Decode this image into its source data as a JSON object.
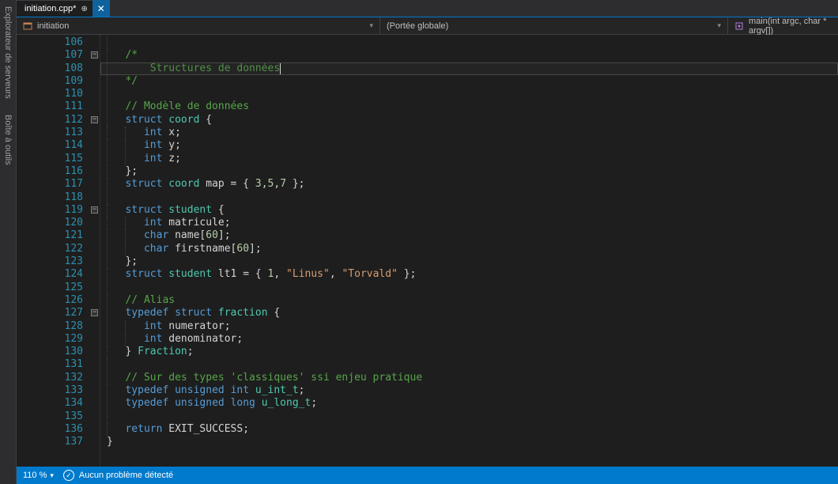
{
  "side_panels": {
    "explorer": "Explorateur de serveurs",
    "toolbox": "Boîte à outils"
  },
  "tab": {
    "title": "initiation.cpp*"
  },
  "nav": {
    "scope1": "initiation",
    "scope2": "(Portée globale)",
    "scope3": "main(int argc, char * argv[])"
  },
  "code_lines": [
    {
      "num": 106,
      "mark": false,
      "fold": "",
      "html": ""
    },
    {
      "num": 107,
      "mark": false,
      "fold": "box",
      "html": "<span class='c-comment'>/*</span>"
    },
    {
      "num": 108,
      "mark": false,
      "fold": "",
      "html": "<span class='c-comment'>    Structures de données</span>",
      "highlight": true
    },
    {
      "num": 109,
      "mark": false,
      "fold": "",
      "html": "<span class='c-comment'>*/</span>"
    },
    {
      "num": 110,
      "mark": true,
      "fold": "",
      "html": ""
    },
    {
      "num": 111,
      "mark": true,
      "fold": "",
      "html": "<span class='c-comment'>// Modèle de données</span>"
    },
    {
      "num": 112,
      "mark": true,
      "fold": "box",
      "html": "<span class='c-kw'>struct</span> <span class='c-type'>coord</span> {"
    },
    {
      "num": 113,
      "mark": false,
      "fold": "",
      "html": "    <span class='c-kw'>int</span> x;"
    },
    {
      "num": 114,
      "mark": false,
      "fold": "",
      "html": "    <span class='c-kw'>int</span> y;"
    },
    {
      "num": 115,
      "mark": false,
      "fold": "",
      "html": "    <span class='c-kw'>int</span> z;"
    },
    {
      "num": 116,
      "mark": false,
      "fold": "",
      "html": "};"
    },
    {
      "num": 117,
      "mark": true,
      "fold": "",
      "html": "<span class='c-kw'>struct</span> <span class='c-type'>coord</span> map = { <span class='c-num'>3</span>,<span class='c-num'>5</span>,<span class='c-num'>7</span> };"
    },
    {
      "num": 118,
      "mark": false,
      "fold": "",
      "html": ""
    },
    {
      "num": 119,
      "mark": false,
      "fold": "box",
      "html": "<span class='c-kw'>struct</span> <span class='c-type'>student</span> {"
    },
    {
      "num": 120,
      "mark": false,
      "fold": "",
      "html": "    <span class='c-kw'>int</span> matricule;"
    },
    {
      "num": 121,
      "mark": false,
      "fold": "",
      "html": "    <span class='c-kw'>char</span> name[<span class='c-num'>60</span>];"
    },
    {
      "num": 122,
      "mark": false,
      "fold": "",
      "html": "    <span class='c-kw'>char</span> firstname[<span class='c-num'>60</span>];"
    },
    {
      "num": 123,
      "mark": false,
      "fold": "",
      "html": "};"
    },
    {
      "num": 124,
      "mark": false,
      "fold": "",
      "html": "<span class='c-kw'>struct</span> <span class='c-type'>student</span> lt1 = { <span class='c-num'>1</span>, <span class='c-str'>\"Linus\"</span>, <span class='c-str'>\"Torvald\"</span> };"
    },
    {
      "num": 125,
      "mark": false,
      "fold": "",
      "html": ""
    },
    {
      "num": 126,
      "mark": true,
      "fold": "",
      "html": "<span class='c-comment'>// Alias</span>"
    },
    {
      "num": 127,
      "mark": true,
      "fold": "box",
      "html": "<span class='c-kw'>typedef</span> <span class='c-kw'>struct</span> <span class='c-type'>fraction</span> {"
    },
    {
      "num": 128,
      "mark": false,
      "fold": "",
      "html": "    <span class='c-kw'>int</span> numerator;"
    },
    {
      "num": 129,
      "mark": false,
      "fold": "",
      "html": "    <span class='c-kw'>int</span> denominator;"
    },
    {
      "num": 130,
      "mark": true,
      "fold": "",
      "html": "} <span class='c-type'>Fraction</span>;"
    },
    {
      "num": 131,
      "mark": false,
      "fold": "",
      "html": ""
    },
    {
      "num": 132,
      "mark": true,
      "fold": "",
      "html": "<span class='c-comment'>// Sur des types 'classiques' ssi enjeu pratique</span>"
    },
    {
      "num": 133,
      "mark": true,
      "fold": "",
      "html": "<span class='c-kw'>typedef</span> <span class='c-kw'>unsigned</span> <span class='c-kw'>int</span> <span class='c-type'>u_int_t</span>;"
    },
    {
      "num": 134,
      "mark": false,
      "fold": "",
      "html": "<span class='c-kw'>typedef</span> <span class='c-kw'>unsigned</span> <span class='c-kw'>long</span> <span class='c-type'>u_long_t</span>;"
    },
    {
      "num": 135,
      "mark": false,
      "fold": "",
      "html": ""
    },
    {
      "num": 136,
      "mark": true,
      "fold": "",
      "html": "<span class='c-kw'>return</span> EXIT_SUCCESS;"
    },
    {
      "num": 137,
      "mark": false,
      "fold": "",
      "html": "}",
      "outdent": true
    }
  ],
  "status": {
    "zoom": "110 %",
    "problems": "Aucun problème détecté"
  }
}
